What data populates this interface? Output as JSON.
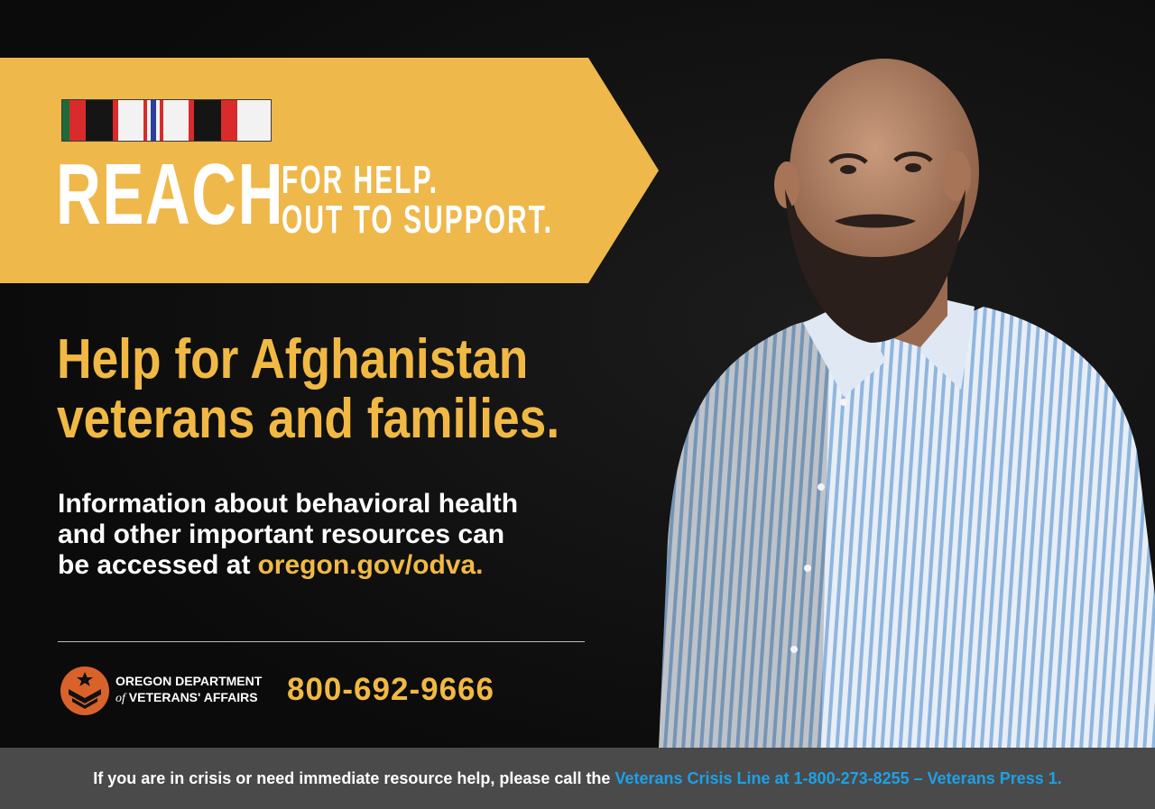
{
  "banner": {
    "main_word": "REACH",
    "line1": "FOR HELP.",
    "line2": "OUT TO SUPPORT."
  },
  "headline": {
    "line1": "Help for Afghanistan",
    "line2": "veterans and families."
  },
  "info": {
    "line1": "Information about behavioral health",
    "line2": "and other important resources can",
    "line3_prefix": "be accessed at",
    "url": "oregon.gov/odva."
  },
  "organization": {
    "line1": "OREGON DEPARTMENT",
    "line2_of": "of",
    "line2_rest": "VETERANS' AFFAIRS"
  },
  "phone": "800-692-9666",
  "footer": {
    "text": "If you are in crisis or need immediate resource help, please call the",
    "crisis_line": "Veterans Crisis Line at 1-800-273-8255 – Veterans Press 1."
  },
  "icons": {
    "ribbon": "service-ribbon-icon",
    "logo": "odva-logo-icon"
  },
  "colors": {
    "accent_yellow": "#f1b944",
    "banner_yellow": "#efb84b",
    "background": "#0d0d0d",
    "footer_bg": "#4a4a4a",
    "crisis_blue": "#1ea0e6",
    "logo_orange": "#d9622b"
  }
}
